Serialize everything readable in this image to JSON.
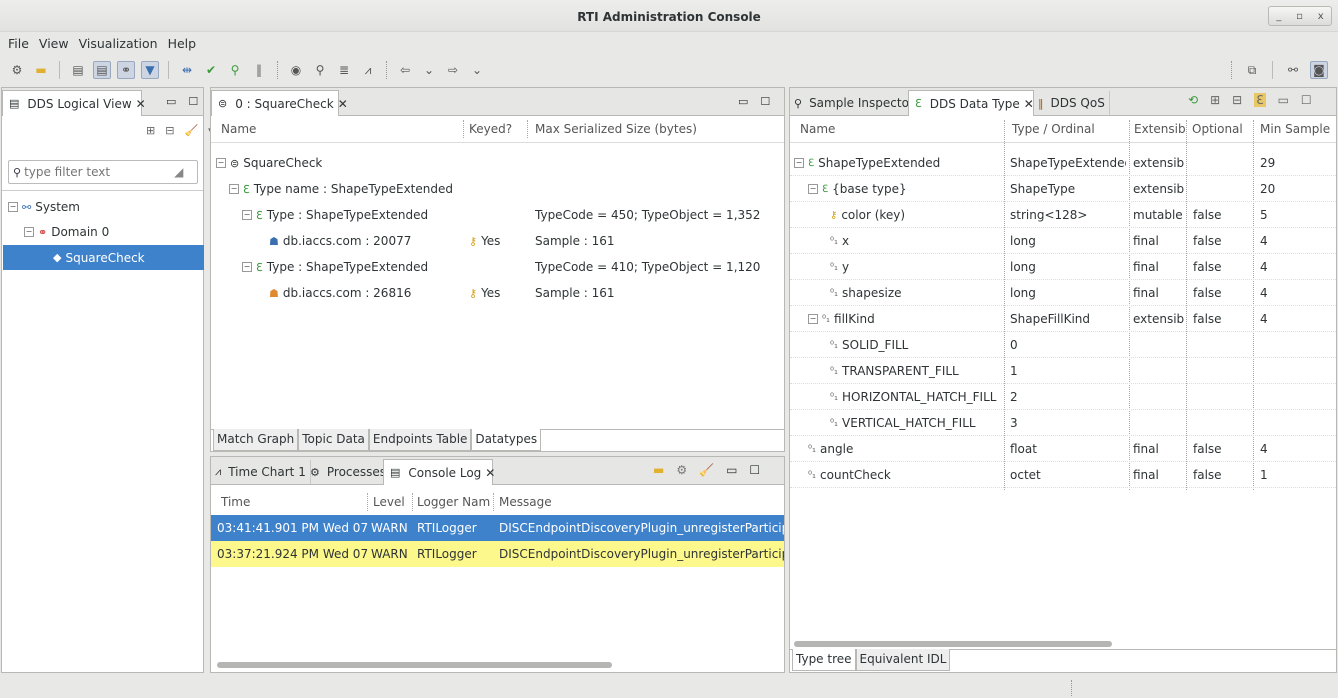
{
  "window": {
    "title": "RTI Administration Console",
    "ctrl_min": "_",
    "ctrl_max": "▫",
    "ctrl_close": "x"
  },
  "menu": [
    "File",
    "View",
    "Visualization",
    "Help"
  ],
  "left": {
    "tab": "DDS Logical View",
    "filter_placeholder": "type filter text",
    "tree": [
      "System",
      "Domain 0",
      "SquareCheck"
    ]
  },
  "center": {
    "tab": "0 : SquareCheck",
    "columns": [
      "Name",
      "Keyed?",
      "Max Serialized Size (bytes)"
    ],
    "rows": [
      {
        "name": "SquareCheck",
        "keyed": "",
        "size": ""
      },
      {
        "name": "Type name : ShapeTypeExtended",
        "keyed": "",
        "size": ""
      },
      {
        "name": "Type : ShapeTypeExtended",
        "keyed": "",
        "size": "TypeCode = 450; TypeObject = 1,352"
      },
      {
        "name": "db.iaccs.com : 20077",
        "keyed": "Yes",
        "size": "Sample : 161"
      },
      {
        "name": "Type : ShapeTypeExtended",
        "keyed": "",
        "size": "TypeCode = 410; TypeObject = 1,120"
      },
      {
        "name": "db.iaccs.com : 26816",
        "keyed": "Yes",
        "size": "Sample : 161"
      }
    ],
    "bottom_tabs": [
      "Match Graph",
      "Topic Data",
      "Endpoints Table",
      "Datatypes"
    ]
  },
  "console": {
    "tabs": [
      "Time Chart 1",
      "Processes",
      "Console Log"
    ],
    "columns": [
      "Time",
      "Level",
      "Logger Nam",
      "Message"
    ],
    "rows": [
      {
        "time": "03:41:41.901 PM Wed 07",
        "level": "WARN",
        "logger": "RTILogger",
        "message": "DISCEndpointDiscoveryPlugin_unregisterParticipant"
      },
      {
        "time": "03:37:21.924 PM Wed 07",
        "level": "WARN",
        "logger": "RTILogger",
        "message": "DISCEndpointDiscoveryPlugin_unregisterParticipant"
      }
    ]
  },
  "right": {
    "tabs": [
      "Sample Inspector",
      "DDS Data Type",
      "DDS QoS"
    ],
    "columns": [
      "Name",
      "Type / Ordinal",
      "Extensib",
      "Optional",
      "Min Sample"
    ],
    "rows": [
      {
        "name": "ShapeTypeExtended",
        "type": "ShapeTypeExtended",
        "ext": "extensible",
        "opt": "",
        "min": "29"
      },
      {
        "name": "{base type}",
        "type": "ShapeType",
        "ext": "extensible",
        "opt": "",
        "min": "20"
      },
      {
        "name": "color (key)",
        "type": "string<128>",
        "ext": "mutable",
        "opt": "false",
        "min": "5"
      },
      {
        "name": "x",
        "type": "long",
        "ext": "final",
        "opt": "false",
        "min": "4"
      },
      {
        "name": "y",
        "type": "long",
        "ext": "final",
        "opt": "false",
        "min": "4"
      },
      {
        "name": "shapesize",
        "type": "long",
        "ext": "final",
        "opt": "false",
        "min": "4"
      },
      {
        "name": "fillKind",
        "type": "ShapeFillKind",
        "ext": "extensible",
        "opt": "false",
        "min": "4"
      },
      {
        "name": "SOLID_FILL",
        "type": "0",
        "ext": "",
        "opt": "",
        "min": ""
      },
      {
        "name": "TRANSPARENT_FILL",
        "type": "1",
        "ext": "",
        "opt": "",
        "min": ""
      },
      {
        "name": "HORIZONTAL_HATCH_FILL",
        "type": "2",
        "ext": "",
        "opt": "",
        "min": ""
      },
      {
        "name": "VERTICAL_HATCH_FILL",
        "type": "3",
        "ext": "",
        "opt": "",
        "min": ""
      },
      {
        "name": "angle",
        "type": "float",
        "ext": "final",
        "opt": "false",
        "min": "4"
      },
      {
        "name": "countCheck",
        "type": "octet",
        "ext": "final",
        "opt": "false",
        "min": "1"
      }
    ],
    "bottom_tabs": [
      "Type tree",
      "Equivalent IDL"
    ]
  }
}
